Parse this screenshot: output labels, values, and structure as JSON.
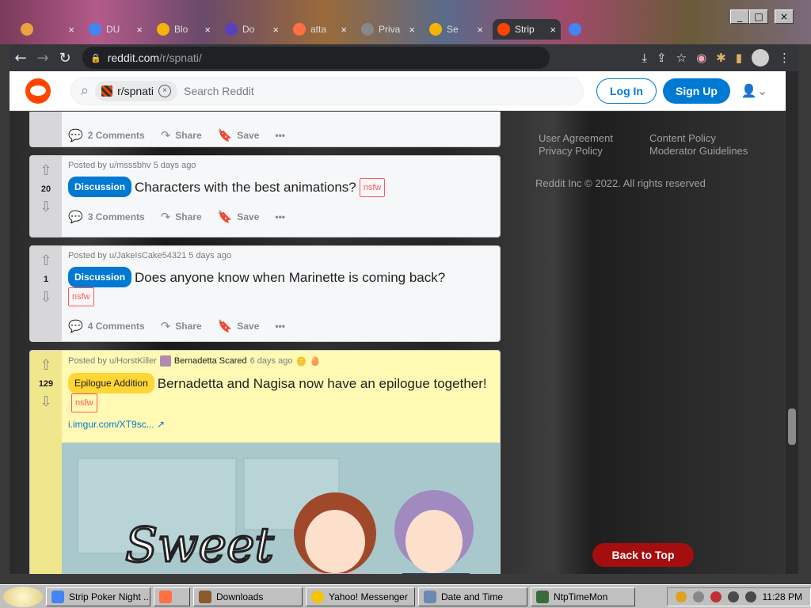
{
  "browser": {
    "tabs": [
      {
        "label": "",
        "color": "#e8a33c"
      },
      {
        "label": "DU",
        "color": "#4285f4"
      },
      {
        "label": "Blo",
        "color": "#f4b400"
      },
      {
        "label": "Do",
        "color": "#5a3fbf"
      },
      {
        "label": "atta",
        "color": "#ff7043"
      },
      {
        "label": "Priva",
        "color": "#888888"
      },
      {
        "label": "Se",
        "color": "#f4b400"
      },
      {
        "label": "Strip",
        "color": "#ff4500"
      },
      {
        "label": "",
        "color": "#4285f4"
      }
    ],
    "url_host": "reddit.com",
    "url_path": "/r/spnati/"
  },
  "header": {
    "community_chip": "r/spnati",
    "search_placeholder": "Search Reddit",
    "login_label": "Log In",
    "signup_label": "Sign Up"
  },
  "posts": [
    {
      "comments": "2 Comments",
      "share": "Share",
      "save": "Save"
    },
    {
      "author": "Posted by u/msssbhv 5 days ago",
      "score": "20",
      "flair": "Discussion",
      "title": "Characters with the best animations?",
      "nsfw": "nsfw",
      "comments": "3 Comments",
      "share": "Share",
      "save": "Save"
    },
    {
      "author": "Posted by u/JakeIsCake54321 5 days ago",
      "score": "1",
      "flair": "Discussion",
      "title": "Does anyone know when Marinette is coming back?",
      "nsfw": "nsfw",
      "comments": "4 Comments",
      "share": "Share",
      "save": "Save"
    },
    {
      "author": "Posted by u/HorstKiller",
      "user_flair": "Bernadetta Scared",
      "age": "6 days ago",
      "score": "129",
      "flair": "Epilogue Addition",
      "title": "Bernadetta and Nagisa now have an epilogue together!",
      "nsfw": "nsfw",
      "link": "i.imgur.com/XT9sc..."
    }
  ],
  "sidebar": {
    "user_agreement": "User Agreement",
    "privacy_policy": "Privacy Policy",
    "content_policy": "Content Policy",
    "moderator_guidelines": "Moderator Guidelines",
    "copyright": "Reddit Inc © 2022. All rights reserved"
  },
  "back_to_top": "Back to Top",
  "taskbar": {
    "tasks": [
      {
        "label": "Strip Poker Night ...",
        "color": "#4285f4"
      },
      {
        "label": "",
        "color": "#ff7043"
      },
      {
        "label": "Downloads",
        "color": "#8a5a2a"
      },
      {
        "label": "Yahoo! Messenger",
        "color": "#f4c400"
      },
      {
        "label": "Date and Time",
        "color": "#6a8ab0"
      },
      {
        "label": "NtpTimeMon",
        "color": "#3a6a3a"
      }
    ],
    "clock": "11:28 PM"
  },
  "colors": {
    "reddit_orange": "#ff4500",
    "reddit_blue": "#0079d3",
    "flair_yellow": "#ffd635",
    "back_to_top": "#a50e0e"
  }
}
